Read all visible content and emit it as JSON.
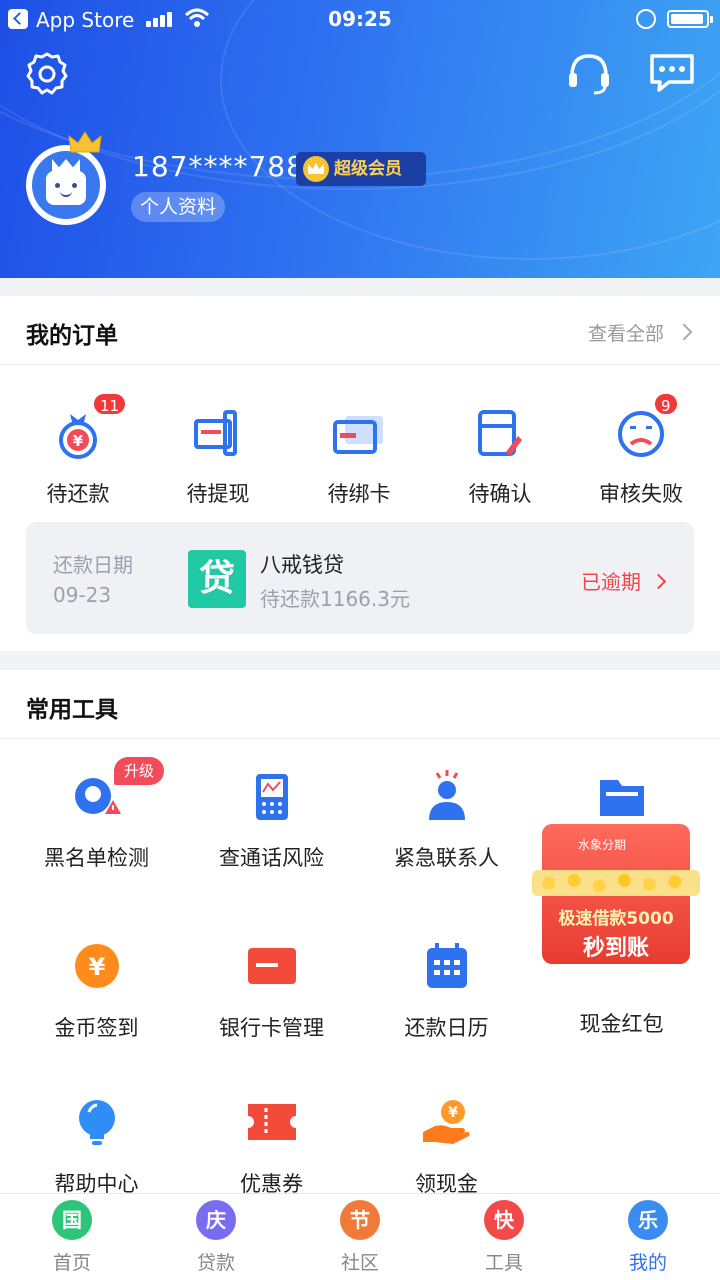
{
  "status_bar": {
    "carrier": "App Store",
    "time": "09:25"
  },
  "header": {
    "phone": "187****7881",
    "vip_label": "超级会员",
    "profile_label": "个人资料"
  },
  "orders": {
    "title": "我的订单",
    "view_all": "查看全部",
    "items": [
      {
        "label": "待还款",
        "badge": "11"
      },
      {
        "label": "待提现",
        "badge": ""
      },
      {
        "label": "待绑卡",
        "badge": ""
      },
      {
        "label": "待确认",
        "badge": ""
      },
      {
        "label": "审核失败",
        "badge": "9"
      }
    ],
    "repayment": {
      "date_label": "还款日期",
      "date": "09-23",
      "logo_text": "贷",
      "product_name": "八戒钱贷",
      "amount_text": "待还款1166.3元",
      "status": "已逾期"
    }
  },
  "tools": {
    "title": "常用工具",
    "upgrade_badge": "升级",
    "items": [
      {
        "label": "黑名单检测",
        "icon": "blacklist-check-icon"
      },
      {
        "label": "查通话风险",
        "icon": "call-risk-icon"
      },
      {
        "label": "紧急联系人",
        "icon": "emergency-contact-icon"
      },
      {
        "label": "",
        "icon": "folder-icon"
      },
      {
        "label": "金币签到",
        "icon": "coin-checkin-icon"
      },
      {
        "label": "银行卡管理",
        "icon": "bank-card-icon"
      },
      {
        "label": "还款日历",
        "icon": "calendar-icon"
      },
      {
        "label": "现金红包",
        "icon": "red-packet-icon"
      },
      {
        "label": "帮助中心",
        "icon": "lightbulb-icon"
      },
      {
        "label": "优惠券",
        "icon": "coupon-icon"
      },
      {
        "label": "领现金",
        "icon": "cash-hand-icon"
      }
    ]
  },
  "promo": {
    "brand": "水象分期",
    "line1": "极速借款5000",
    "line2": "秒到账"
  },
  "tabbar": {
    "items": [
      {
        "icon_char": "国",
        "label": "首页",
        "color": "#2ec47a"
      },
      {
        "icon_char": "庆",
        "label": "贷款",
        "color": "#7a6cf0"
      },
      {
        "icon_char": "节",
        "label": "社区",
        "color": "#f07a3a"
      },
      {
        "icon_char": "快",
        "label": "工具",
        "color": "#f04a4a"
      },
      {
        "icon_char": "乐",
        "label": "我的",
        "color": "#3a8cf0"
      }
    ],
    "active_index": 4
  },
  "colors": {
    "accent": "#2f72f0",
    "alert": "#f03a3a",
    "overdue": "#f0464e",
    "teal": "#20c9a3"
  }
}
